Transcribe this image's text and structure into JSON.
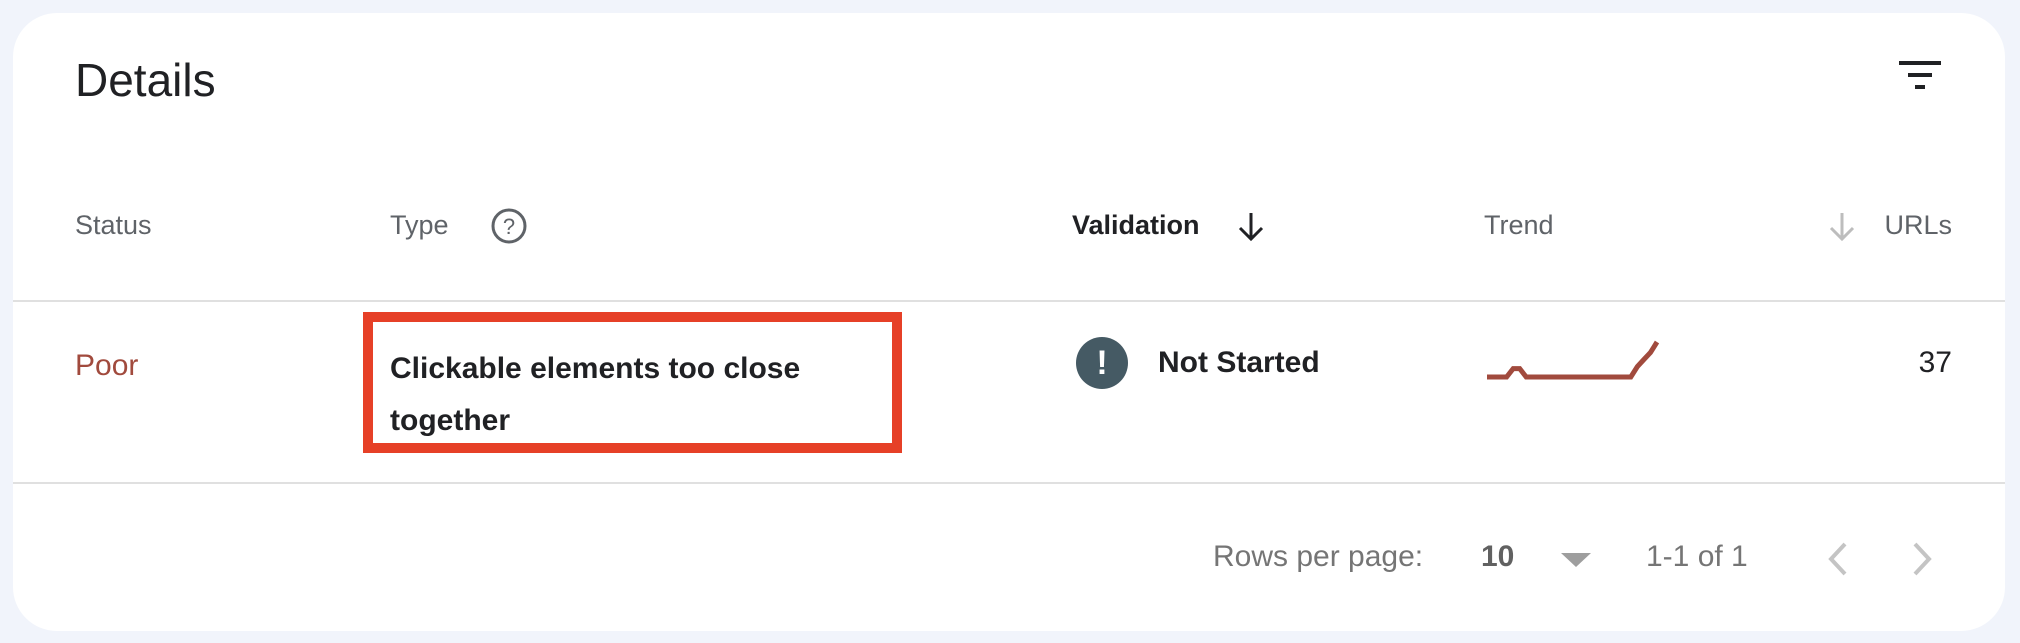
{
  "header": {
    "title": "Details",
    "filter_icon": "filter-icon"
  },
  "table": {
    "columns": [
      {
        "label": "Status"
      },
      {
        "label": "Type",
        "icon": "help-circle-icon"
      },
      {
        "label": "Validation",
        "sort": "descending",
        "icon": "arrow-down-icon"
      },
      {
        "label": "Trend"
      },
      {
        "label": "URLs",
        "icon": "arrow-down-icon"
      }
    ],
    "rows": [
      {
        "status": "Poor",
        "type": "Clickable elements too close together",
        "validation_icon": "exclamation-icon",
        "validation": "Not Started",
        "trend": [
          1,
          1,
          1,
          1,
          2.2,
          2.2,
          1,
          1,
          1,
          1,
          1,
          1,
          1,
          1,
          1,
          1,
          1,
          1,
          1,
          1,
          1,
          1,
          1,
          2.5,
          3.5,
          4.5,
          6
        ],
        "urls": "37"
      }
    ]
  },
  "pagination": {
    "rows_per_page_label": "Rows per page:",
    "rows_per_page_value": "10",
    "range": "1-1 of 1"
  },
  "colors": {
    "poor": "#a14a3d",
    "highlight_box": "#e64027",
    "badge": "#455a64",
    "background": "#f1f4fb"
  }
}
